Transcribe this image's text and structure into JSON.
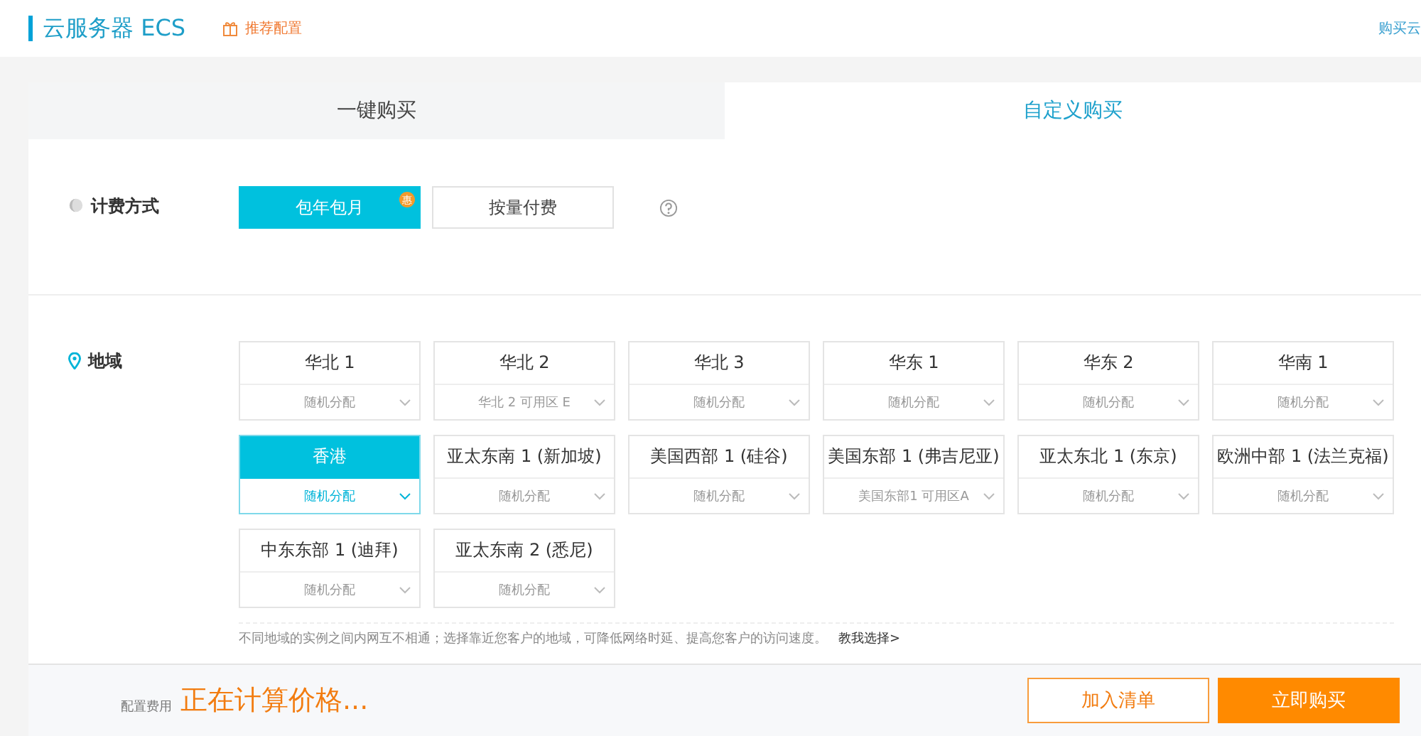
{
  "header": {
    "title": "云服务器 ECS",
    "promo": "推荐配置",
    "right_link": "购买云"
  },
  "tabs": [
    {
      "label": "一键购买",
      "selected": false
    },
    {
      "label": "自定义购买",
      "selected": true
    }
  ],
  "billing": {
    "label": "计费方式",
    "options": [
      {
        "label": "包年包月",
        "selected": true,
        "badge": "惠"
      },
      {
        "label": "按量付费",
        "selected": false
      }
    ]
  },
  "region": {
    "label": "地域",
    "items": [
      {
        "name": "华北 1",
        "zone": "随机分配",
        "selected": false
      },
      {
        "name": "华北 2",
        "zone": "华北 2 可用区 E",
        "selected": false
      },
      {
        "name": "华北 3",
        "zone": "随机分配",
        "selected": false
      },
      {
        "name": "华东 1",
        "zone": "随机分配",
        "selected": false
      },
      {
        "name": "华东 2",
        "zone": "随机分配",
        "selected": false
      },
      {
        "name": "华南 1",
        "zone": "随机分配",
        "selected": false
      },
      {
        "name": "香港",
        "zone": "随机分配",
        "selected": true
      },
      {
        "name": "亚太东南 1 (新加坡)",
        "zone": "随机分配",
        "selected": false
      },
      {
        "name": "美国西部 1 (硅谷)",
        "zone": "随机分配",
        "selected": false
      },
      {
        "name": "美国东部 1 (弗吉尼亚)",
        "zone": "美国东部1 可用区A",
        "selected": false
      },
      {
        "name": "亚太东北 1 (东京)",
        "zone": "随机分配",
        "selected": false
      },
      {
        "name": "欧洲中部 1 (法兰克福)",
        "zone": "随机分配",
        "selected": false
      },
      {
        "name": "中东东部 1 (迪拜)",
        "zone": "随机分配",
        "selected": false
      },
      {
        "name": "亚太东南 2 (悉尼)",
        "zone": "随机分配",
        "selected": false
      }
    ],
    "note": "不同地域的实例之间内网互不相通；选择靠近您客户的地域，可降低网络时延、提高您客户的访问速度。",
    "note_link": "教我选择>"
  },
  "footer": {
    "cost_label": "配置费用",
    "price": "正在计算价格...",
    "buttons": [
      {
        "label": "加入清单",
        "kind": "outline"
      },
      {
        "label": "立即购买",
        "kind": "primary"
      }
    ]
  }
}
